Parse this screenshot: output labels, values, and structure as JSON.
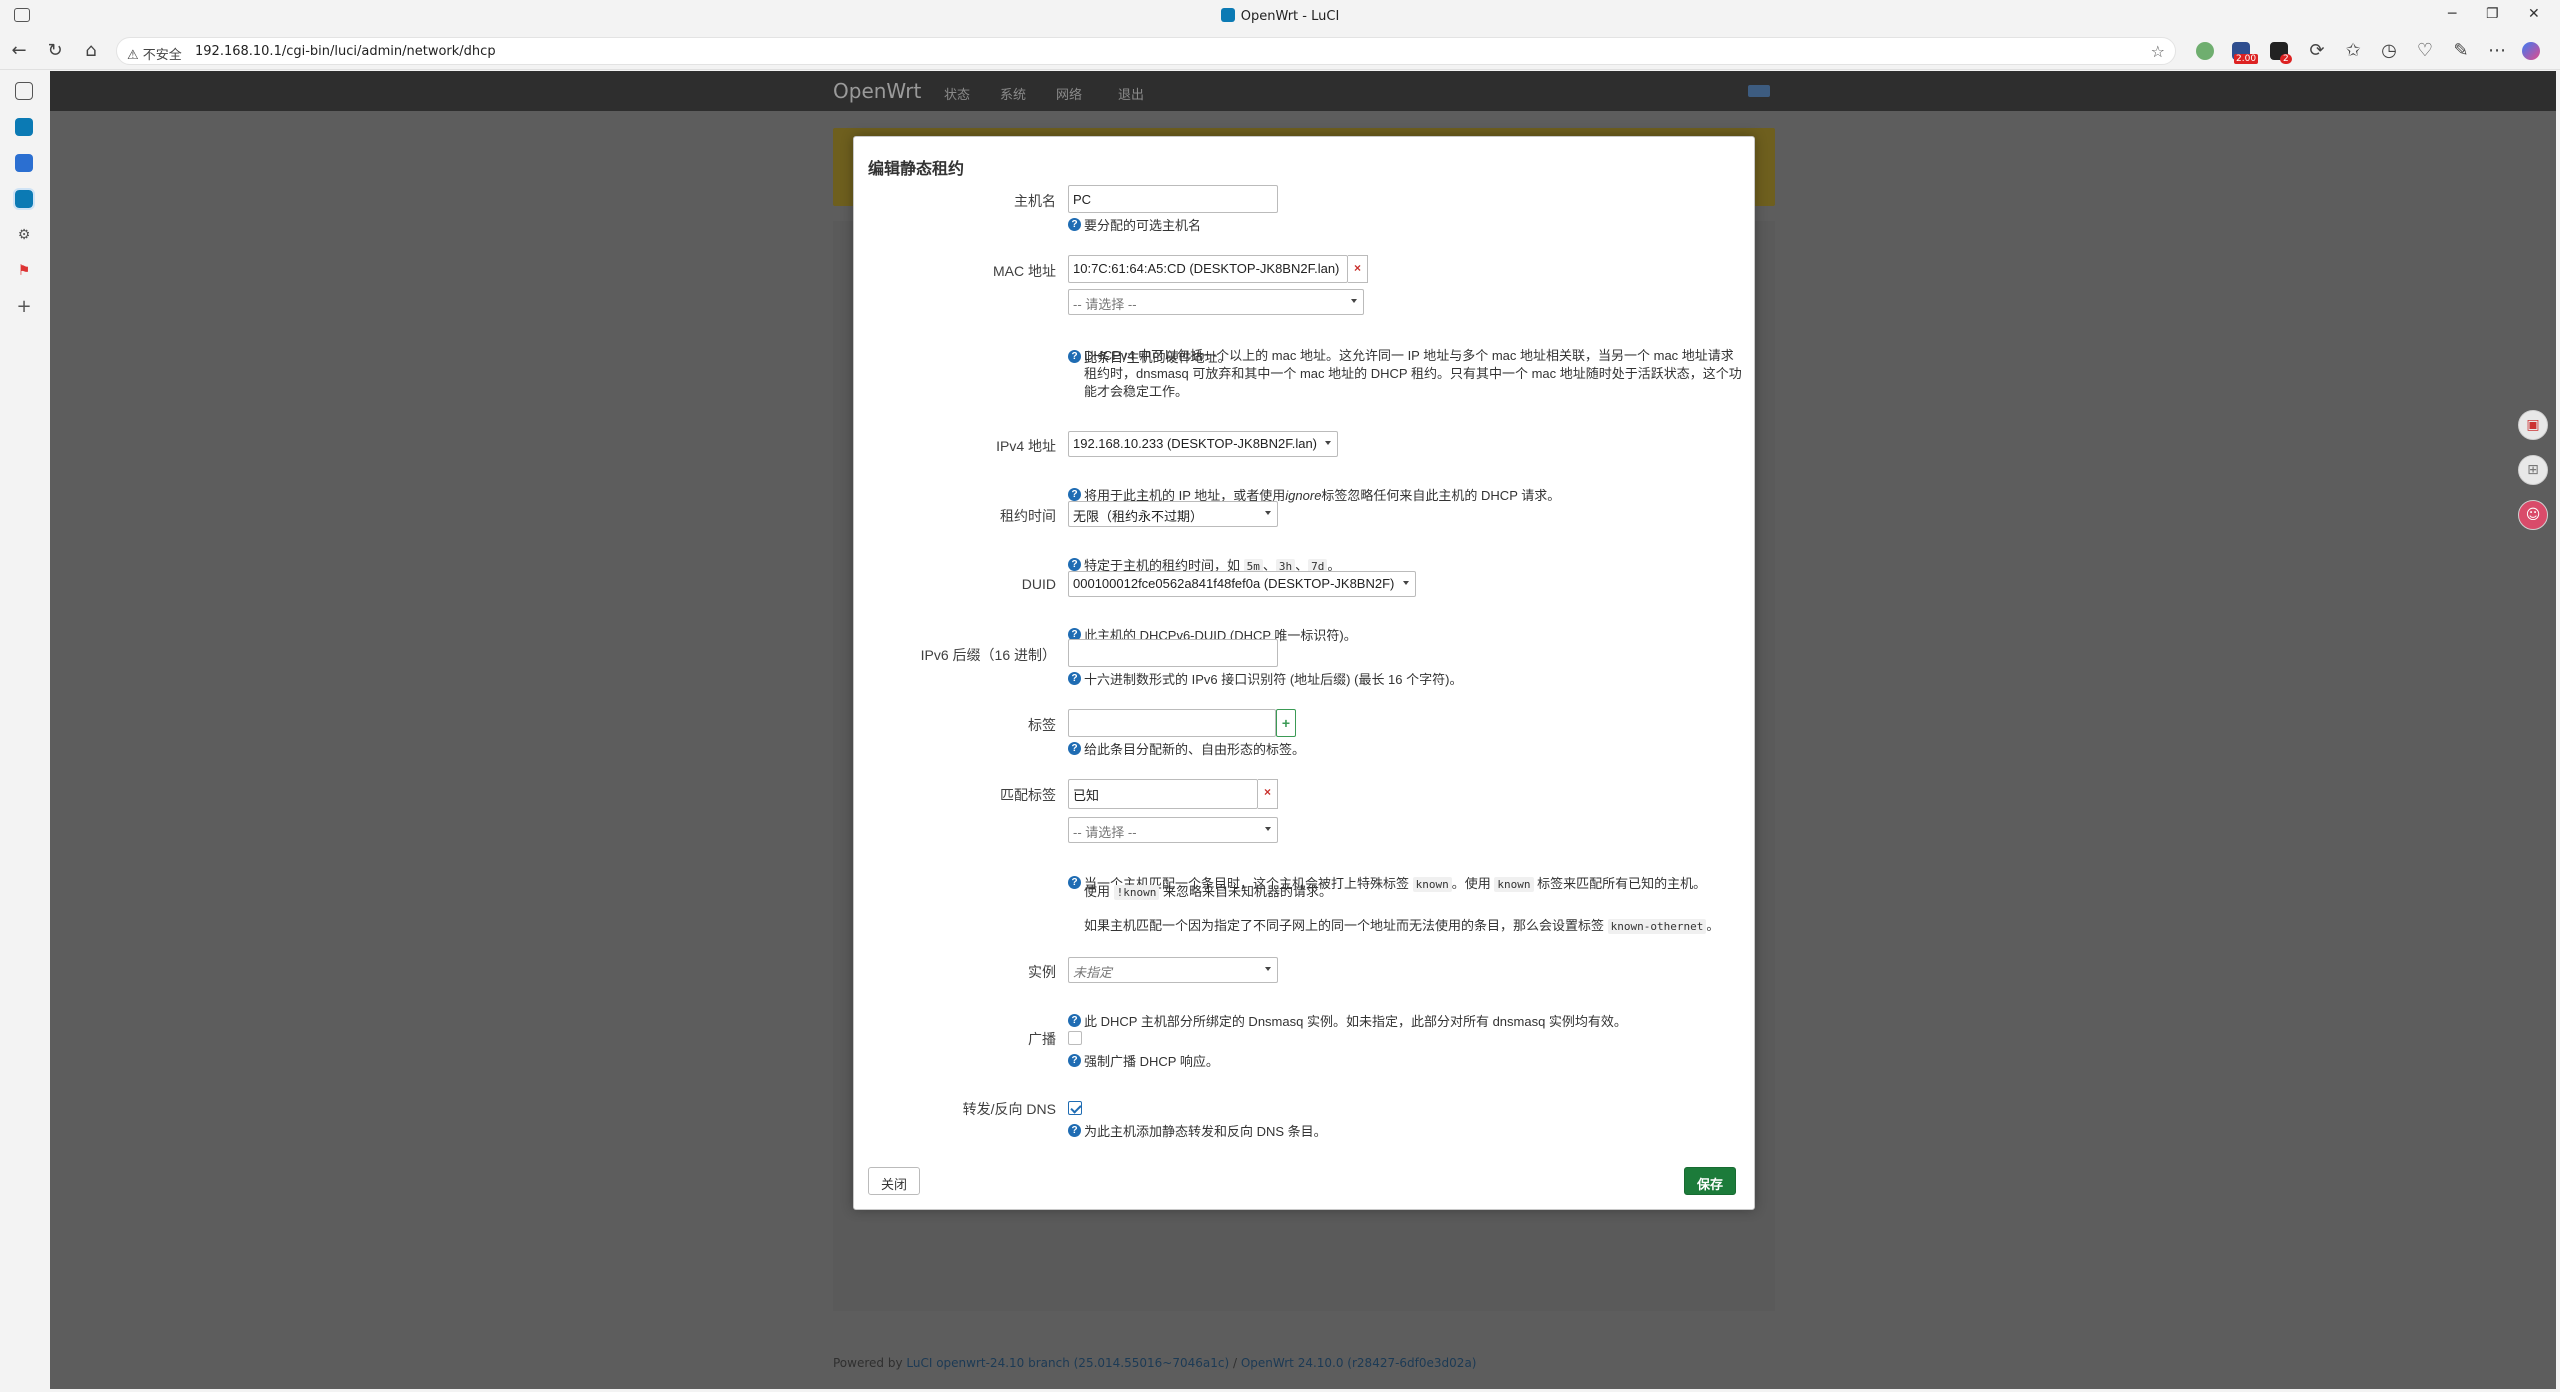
{
  "browser": {
    "window_title": "OpenWrt - LuCI",
    "security_label": "不安全",
    "url": "192.168.10.1/cgi-bin/luci/admin/network/dhcp",
    "ext_badge_1": "2.00",
    "ext_badge_2": "2"
  },
  "openwrt": {
    "brand": "OpenWrt",
    "menu": [
      "状态",
      "系统",
      "网络",
      "退出"
    ],
    "footer_prefix": "Powered by",
    "footer_link1": "LuCI openwrt-24.10 branch (25.014.55016~7046a1c)",
    "footer_sep": "/",
    "footer_link2": "OpenWrt 24.10.0 (r28427-6df0e3d02a)"
  },
  "modal": {
    "title": "编辑静态租约",
    "hostname": {
      "label": "主机名",
      "value": "PC",
      "help": "要分配的可选主机名"
    },
    "mac": {
      "label": "MAC 地址",
      "value": "10:7C:61:64:A5:CD (DESKTOP-JK8BN2F.lan)",
      "select_placeholder": "-- 请选择 --",
      "help": "此条目/主机的硬件地址。",
      "note": "DHCPv4 中可以包括一个以上的 mac 地址。这允许同一 IP 地址与多个 mac 地址相关联，当另一个 mac 地址请求租约时，dnsmasq 可放弃和其中一个 mac 地址的 DHCP 租约。只有其中一个 mac 地址随时处于活跃状态，这个功能才会稳定工作。"
    },
    "ipv4": {
      "label": "IPv4 地址",
      "value": "192.168.10.233 (DESKTOP-JK8BN2F.lan)",
      "help_pre": "将用于此主机的 IP 地址，或者使用",
      "help_em": "ignore",
      "help_post": "标签忽略任何来自此主机的 DHCP 请求。"
    },
    "leasetime": {
      "label": "租约时间",
      "value": "无限（租约永不过期）",
      "help_pre": "特定于主机的租约时间，如",
      "codes": [
        "5m",
        "3h",
        "7d"
      ],
      "help_sep": "、",
      "help_end": "。"
    },
    "duid": {
      "label": "DUID",
      "value": "000100012fce0562a841f48fef0a (DESKTOP-JK8BN2F)",
      "help": "此主机的 DHCPv6-DUID (DHCP 唯一标识符)。"
    },
    "ipv6suffix": {
      "label": "IPv6 后缀（16 进制）",
      "value": "",
      "help": "十六进制数形式的 IPv6 接口识别符 (地址后缀) (最长 16 个字符)。"
    },
    "tag": {
      "label": "标签",
      "value": "",
      "plus": "+",
      "help": "给此条目分配新的、自由形态的标签。"
    },
    "matchtag": {
      "label": "匹配标签",
      "value": "已知",
      "remove": "×",
      "select_placeholder": "-- 请选择 --",
      "help_pre": "当一个主机匹配一个条目时，这个主机会被打上特殊标签",
      "help_code1": "known",
      "help_mid": "。使用",
      "help_code2": "known",
      "help_post": "标签来匹配所有已知的主机。",
      "note1_pre": "使用",
      "note1_code": "!known",
      "note1_post": "来忽略来自未知机器的请求。",
      "note2_pre": "如果主机匹配一个因为指定了不同子网上的同一个地址而无法使用的条目，那么会设置标签",
      "note2_code": "known-othernet",
      "note2_post": "。"
    },
    "instance": {
      "label": "实例",
      "value": "未指定",
      "help": "此 DHCP 主机部分所绑定的 Dnsmasq 实例。如未指定，此部分对所有 dnsmasq 实例均有效。"
    },
    "broadcast": {
      "label": "广播",
      "checked": false,
      "help": "强制广播 DHCP 响应。"
    },
    "dns": {
      "label": "转发/反向 DNS",
      "checked": true,
      "help": "为此主机添加静态转发和反向 DNS 条目。"
    },
    "close_label": "关闭",
    "save_label": "保存"
  },
  "colors": {
    "save": "#1c7b3a",
    "help_icon": "#1f6cb3",
    "remove": "#c9302c",
    "add": "#3b9a55"
  }
}
